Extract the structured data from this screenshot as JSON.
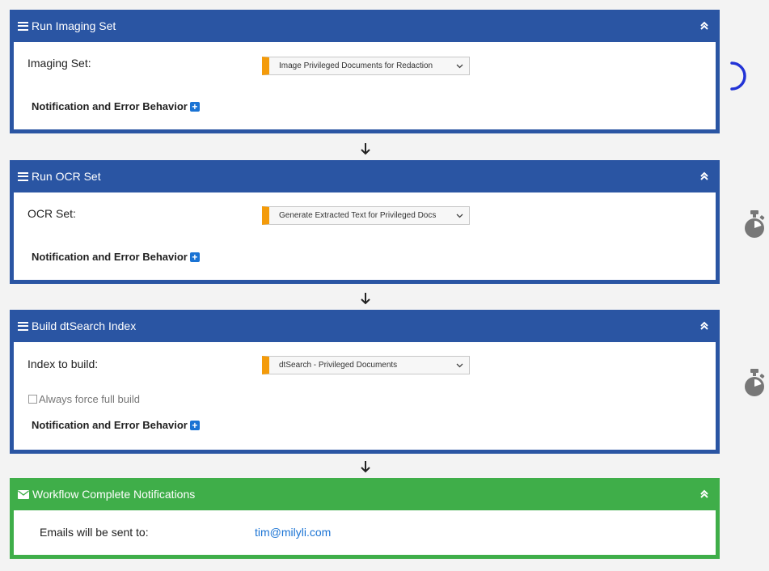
{
  "steps": [
    {
      "title": "Run Imaging Set",
      "field_label": "Imaging Set:",
      "selected_value": "Image Privileged Documents for Redaction",
      "notification_label": "Notification and Error Behavior",
      "status_icon": "loading-spinner-icon"
    },
    {
      "title": "Run OCR Set",
      "field_label": "OCR Set:",
      "selected_value": "Generate Extracted Text for Privileged Docs",
      "notification_label": "Notification and Error Behavior",
      "status_icon": "stopwatch-icon"
    },
    {
      "title": "Build dtSearch Index",
      "field_label": "Index to build:",
      "selected_value": "dtSearch - Privileged Documents",
      "checkbox_label": "Always force full build",
      "checkbox_checked": false,
      "notification_label": "Notification and Error Behavior",
      "status_icon": "stopwatch-icon"
    }
  ],
  "complete": {
    "title": "Workflow Complete Notifications",
    "emails_label": "Emails will be sent to:",
    "email": "tim@milyli.com"
  },
  "colors": {
    "step_header": "#2a55a3",
    "complete_header": "#3fae49",
    "select_accent": "#f49b0a",
    "link": "#1a73d4",
    "spinner": "#2233d6",
    "stopwatch": "#777777"
  }
}
